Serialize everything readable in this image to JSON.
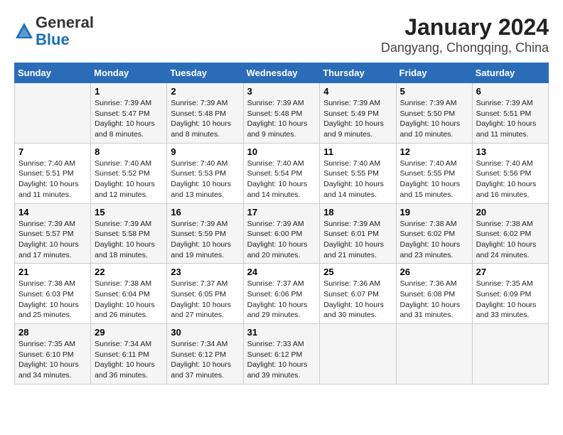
{
  "logo": {
    "general": "General",
    "blue": "Blue"
  },
  "title": "January 2024",
  "subtitle": "Dangyang, Chongqing, China",
  "headers": [
    "Sunday",
    "Monday",
    "Tuesday",
    "Wednesday",
    "Thursday",
    "Friday",
    "Saturday"
  ],
  "weeks": [
    [
      {
        "day": "",
        "info": ""
      },
      {
        "day": "1",
        "info": "Sunrise: 7:39 AM\nSunset: 5:47 PM\nDaylight: 10 hours\nand 8 minutes."
      },
      {
        "day": "2",
        "info": "Sunrise: 7:39 AM\nSunset: 5:48 PM\nDaylight: 10 hours\nand 8 minutes."
      },
      {
        "day": "3",
        "info": "Sunrise: 7:39 AM\nSunset: 5:48 PM\nDaylight: 10 hours\nand 9 minutes."
      },
      {
        "day": "4",
        "info": "Sunrise: 7:39 AM\nSunset: 5:49 PM\nDaylight: 10 hours\nand 9 minutes."
      },
      {
        "day": "5",
        "info": "Sunrise: 7:39 AM\nSunset: 5:50 PM\nDaylight: 10 hours\nand 10 minutes."
      },
      {
        "day": "6",
        "info": "Sunrise: 7:39 AM\nSunset: 5:51 PM\nDaylight: 10 hours\nand 11 minutes."
      }
    ],
    [
      {
        "day": "7",
        "info": "Sunrise: 7:40 AM\nSunset: 5:51 PM\nDaylight: 10 hours\nand 11 minutes."
      },
      {
        "day": "8",
        "info": "Sunrise: 7:40 AM\nSunset: 5:52 PM\nDaylight: 10 hours\nand 12 minutes."
      },
      {
        "day": "9",
        "info": "Sunrise: 7:40 AM\nSunset: 5:53 PM\nDaylight: 10 hours\nand 13 minutes."
      },
      {
        "day": "10",
        "info": "Sunrise: 7:40 AM\nSunset: 5:54 PM\nDaylight: 10 hours\nand 14 minutes."
      },
      {
        "day": "11",
        "info": "Sunrise: 7:40 AM\nSunset: 5:55 PM\nDaylight: 10 hours\nand 14 minutes."
      },
      {
        "day": "12",
        "info": "Sunrise: 7:40 AM\nSunset: 5:55 PM\nDaylight: 10 hours\nand 15 minutes."
      },
      {
        "day": "13",
        "info": "Sunrise: 7:40 AM\nSunset: 5:56 PM\nDaylight: 10 hours\nand 16 minutes."
      }
    ],
    [
      {
        "day": "14",
        "info": "Sunrise: 7:39 AM\nSunset: 5:57 PM\nDaylight: 10 hours\nand 17 minutes."
      },
      {
        "day": "15",
        "info": "Sunrise: 7:39 AM\nSunset: 5:58 PM\nDaylight: 10 hours\nand 18 minutes."
      },
      {
        "day": "16",
        "info": "Sunrise: 7:39 AM\nSunset: 5:59 PM\nDaylight: 10 hours\nand 19 minutes."
      },
      {
        "day": "17",
        "info": "Sunrise: 7:39 AM\nSunset: 6:00 PM\nDaylight: 10 hours\nand 20 minutes."
      },
      {
        "day": "18",
        "info": "Sunrise: 7:39 AM\nSunset: 6:01 PM\nDaylight: 10 hours\nand 21 minutes."
      },
      {
        "day": "19",
        "info": "Sunrise: 7:38 AM\nSunset: 6:02 PM\nDaylight: 10 hours\nand 23 minutes."
      },
      {
        "day": "20",
        "info": "Sunrise: 7:38 AM\nSunset: 6:02 PM\nDaylight: 10 hours\nand 24 minutes."
      }
    ],
    [
      {
        "day": "21",
        "info": "Sunrise: 7:38 AM\nSunset: 6:03 PM\nDaylight: 10 hours\nand 25 minutes."
      },
      {
        "day": "22",
        "info": "Sunrise: 7:38 AM\nSunset: 6:04 PM\nDaylight: 10 hours\nand 26 minutes."
      },
      {
        "day": "23",
        "info": "Sunrise: 7:37 AM\nSunset: 6:05 PM\nDaylight: 10 hours\nand 27 minutes."
      },
      {
        "day": "24",
        "info": "Sunrise: 7:37 AM\nSunset: 6:06 PM\nDaylight: 10 hours\nand 29 minutes."
      },
      {
        "day": "25",
        "info": "Sunrise: 7:36 AM\nSunset: 6:07 PM\nDaylight: 10 hours\nand 30 minutes."
      },
      {
        "day": "26",
        "info": "Sunrise: 7:36 AM\nSunset: 6:08 PM\nDaylight: 10 hours\nand 31 minutes."
      },
      {
        "day": "27",
        "info": "Sunrise: 7:35 AM\nSunset: 6:09 PM\nDaylight: 10 hours\nand 33 minutes."
      }
    ],
    [
      {
        "day": "28",
        "info": "Sunrise: 7:35 AM\nSunset: 6:10 PM\nDaylight: 10 hours\nand 34 minutes."
      },
      {
        "day": "29",
        "info": "Sunrise: 7:34 AM\nSunset: 6:11 PM\nDaylight: 10 hours\nand 36 minutes."
      },
      {
        "day": "30",
        "info": "Sunrise: 7:34 AM\nSunset: 6:12 PM\nDaylight: 10 hours\nand 37 minutes."
      },
      {
        "day": "31",
        "info": "Sunrise: 7:33 AM\nSunset: 6:12 PM\nDaylight: 10 hours\nand 39 minutes."
      },
      {
        "day": "",
        "info": ""
      },
      {
        "day": "",
        "info": ""
      },
      {
        "day": "",
        "info": ""
      }
    ]
  ]
}
